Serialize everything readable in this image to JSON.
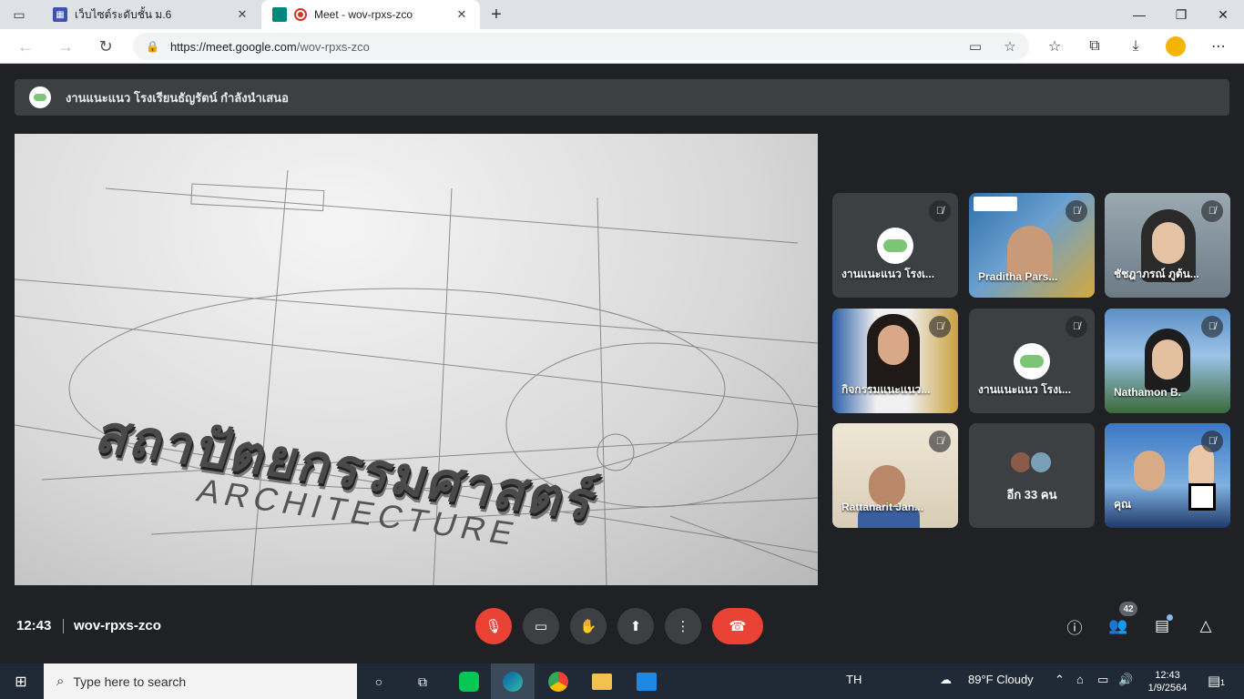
{
  "browser": {
    "tabs": [
      {
        "title": "เว็บไซต์ระดับชั้น ม.6",
        "close": "✕"
      },
      {
        "title": "Meet - wov-rpxs-zco",
        "close": "✕"
      }
    ],
    "new_tab": "+",
    "window_controls": {
      "minimize": "—",
      "restore": "❐",
      "close": "✕"
    },
    "back": "←",
    "forward": "→",
    "reload": "↻",
    "url_host": "https://meet.google.com",
    "url_path": "/wov-rpxs-zco",
    "lock": "🔒",
    "more": "⋯"
  },
  "meet": {
    "presenter_banner": "งานแนะแนว โรงเรียนธัญรัตน์ กำลังนำเสนอ",
    "main_video": {
      "text": "สถาปัตยกรรมศาสตร์",
      "sub": "ARCHITECTURE"
    },
    "participants": [
      {
        "name": "งานแนะแนว โรงเ...",
        "type": "avatar"
      },
      {
        "name": "Praditha Pars...",
        "type": "camera",
        "colors": [
          "#2f6fa8",
          "#d4a83a"
        ]
      },
      {
        "name": "ชัชฎาภรณ์ ภูต้น...",
        "type": "camera",
        "colors": [
          "#8a9aa5",
          "#2c2c2c"
        ]
      },
      {
        "name": "กิจกรรมแนะแนว...",
        "type": "camera",
        "colors": [
          "#2b5ea7",
          "#c9a040"
        ]
      },
      {
        "name": "งานแนะแนว โรงเ...",
        "type": "avatar"
      },
      {
        "name": "Nathamon B.",
        "type": "camera",
        "colors": [
          "#5c8fc7",
          "#3a6a3a"
        ]
      },
      {
        "name": "Rattanarit Jan...",
        "type": "camera",
        "colors": [
          "#e8e0cf",
          "#3a5fa0"
        ]
      },
      {
        "name": "อีก 33 คน",
        "type": "more"
      },
      {
        "name": "คุณ",
        "type": "camera",
        "colors": [
          "#3b78c4",
          "#1f3a6a"
        ]
      }
    ],
    "controls": {
      "time": "12:43",
      "meeting_code": "wov-rpxs-zco",
      "participant_count": "42"
    }
  },
  "taskbar": {
    "search_placeholder": "Type here to search",
    "language": "TH",
    "weather": "89°F  Cloudy",
    "time": "12:43",
    "date": "1/9/2564",
    "notifications": "1"
  }
}
